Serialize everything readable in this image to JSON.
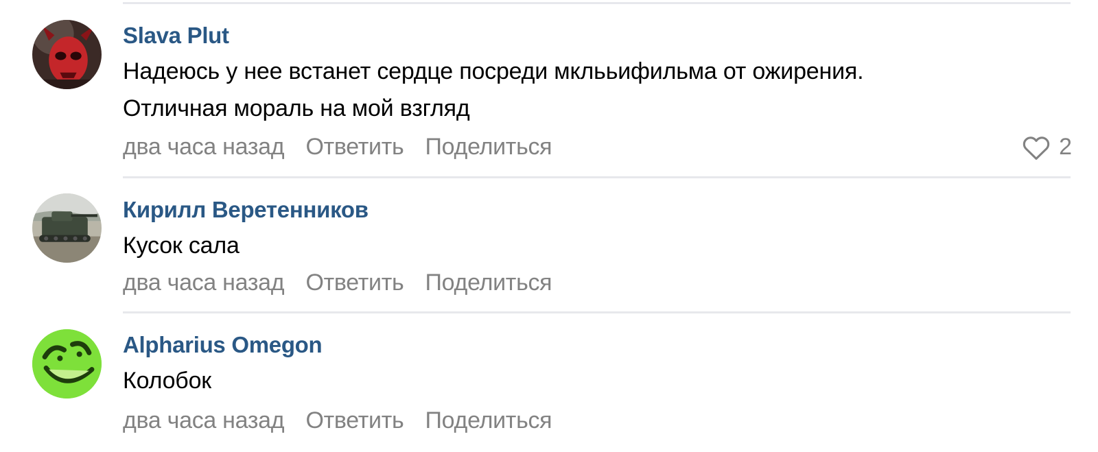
{
  "comments": [
    {
      "author": "Slava Plut",
      "text_lines": [
        "Надеюсь у нее встанет сердце посреди мклььифильма от ожирения.",
        "Отличная мораль на мой взгляд"
      ],
      "time": "два часа назад",
      "reply_label": "Ответить",
      "share_label": "Поделиться",
      "likes": "2",
      "avatar_icon": "red-skull-avatar"
    },
    {
      "author": "Кирилл Веретенников",
      "text_lines": [
        "Кусок сала"
      ],
      "time": "два часа назад",
      "reply_label": "Ответить",
      "share_label": "Поделиться",
      "avatar_icon": "tank-photo-avatar"
    },
    {
      "author": "Alpharius Omegon",
      "text_lines": [
        "Колобок"
      ],
      "time": "два часа назад",
      "reply_label": "Ответить",
      "share_label": "Поделиться",
      "avatar_icon": "green-smiley-avatar"
    }
  ],
  "colors": {
    "author_link": "#2a5885",
    "meta_text": "#828282",
    "divider": "#e7e8ec"
  }
}
